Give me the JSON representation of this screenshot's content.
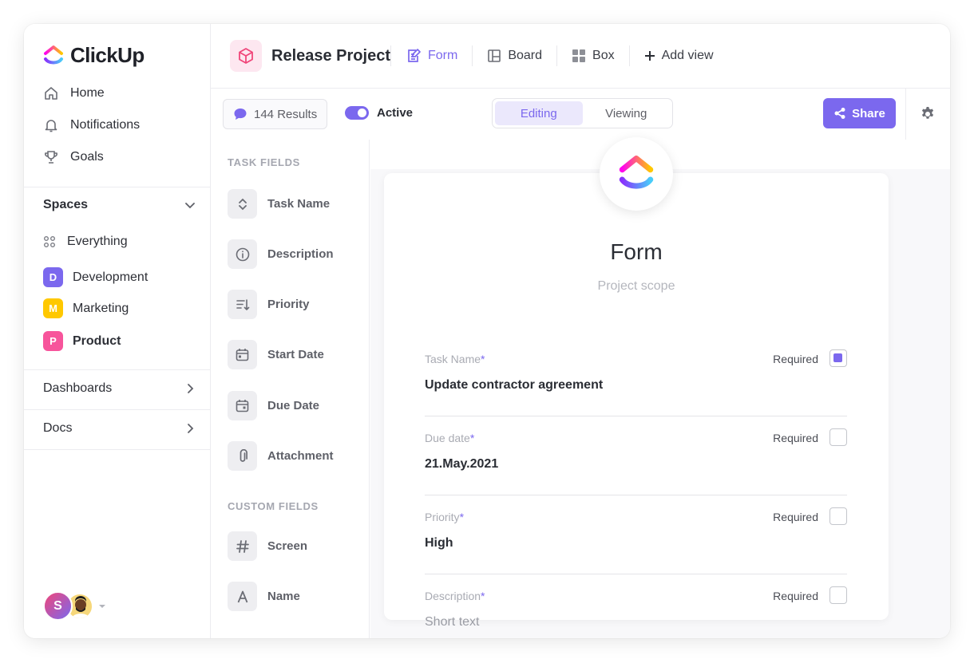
{
  "app": {
    "name": "ClickUp"
  },
  "sidebar": {
    "nav": [
      {
        "label": "Home",
        "icon": "home-icon"
      },
      {
        "label": "Notifications",
        "icon": "bell-icon"
      },
      {
        "label": "Goals",
        "icon": "trophy-icon"
      }
    ],
    "spaces_label": "Spaces",
    "spaces": [
      {
        "label": "Everything",
        "badge": "",
        "color": ""
      },
      {
        "label": "Development",
        "badge": "D",
        "color": "#7b68ee"
      },
      {
        "label": "Marketing",
        "badge": "M",
        "color": "#ffc800"
      },
      {
        "label": "Product",
        "badge": "P",
        "color": "#f7549b"
      }
    ],
    "dashboards_label": "Dashboards",
    "docs_label": "Docs",
    "user_initial": "S"
  },
  "header": {
    "project_title": "Release Project",
    "views": [
      {
        "label": "Form",
        "icon": "form-icon",
        "active": true
      },
      {
        "label": "Board",
        "icon": "board-icon",
        "active": false
      },
      {
        "label": "Box",
        "icon": "box-icon",
        "active": false
      },
      {
        "label": "Add view",
        "icon": "plus-icon",
        "active": false
      }
    ]
  },
  "toolbar": {
    "results": "144 Results",
    "active_label": "Active",
    "segments": [
      "Editing",
      "Viewing"
    ],
    "share_label": "Share"
  },
  "fields": {
    "task_heading": "TASK FIELDS",
    "task_fields": [
      "Task Name",
      "Description",
      "Priority",
      "Start Date",
      "Due Date",
      "Attachment"
    ],
    "custom_heading": "CUSTOM FIELDS",
    "custom_fields": [
      "Screen",
      "Name"
    ]
  },
  "form": {
    "title": "Form",
    "subtitle": "Project scope",
    "required_label": "Required",
    "rows": [
      {
        "label": "Task Name",
        "value": "Update contractor agreement",
        "required": true,
        "placeholder": false
      },
      {
        "label": "Due date",
        "value": "21.May.2021",
        "required": false,
        "placeholder": false
      },
      {
        "label": "Priority",
        "value": "High",
        "required": false,
        "placeholder": false
      },
      {
        "label": "Description",
        "value": "Short text",
        "required": false,
        "placeholder": true
      }
    ]
  },
  "colors": {
    "accent": "#7b68ee",
    "divider": "#ececf0"
  }
}
